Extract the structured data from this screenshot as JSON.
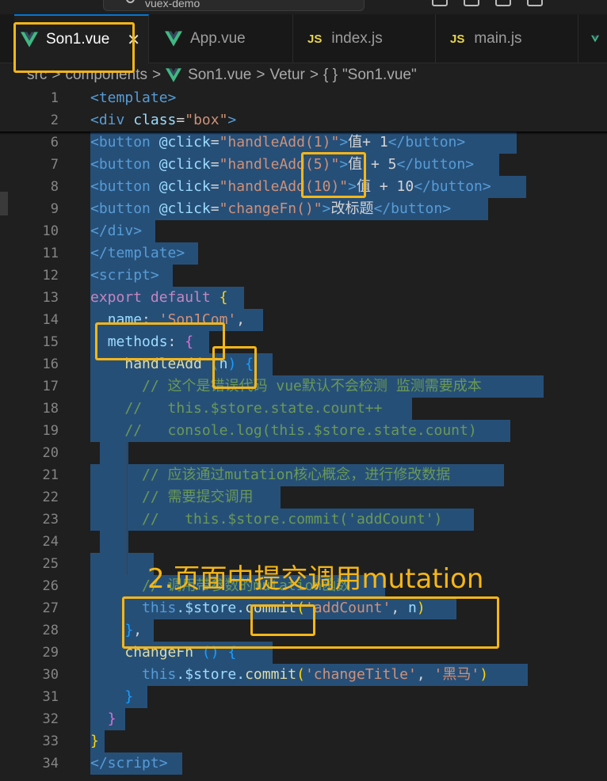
{
  "titlebar": {
    "search_text": "vuex-demo"
  },
  "tabs": [
    {
      "label": "Son1.vue",
      "icon": "vue-icon",
      "active": true,
      "close": "✕"
    },
    {
      "label": "App.vue",
      "icon": "vue-icon"
    },
    {
      "label": "index.js",
      "icon": "js-icon",
      "icon_text": "JS"
    },
    {
      "label": "main.js",
      "icon": "js-icon",
      "icon_text": "JS"
    }
  ],
  "breadcrumb": {
    "items": [
      "src",
      "components",
      "Son1.vue",
      "Vetur",
      "\"Son1.vue\""
    ],
    "separator": ">",
    "braces": "{ }"
  },
  "editor": {
    "lines": [
      {
        "no": "1"
      },
      {
        "no": "2"
      },
      {
        "no": "6"
      },
      {
        "no": "7"
      },
      {
        "no": "8"
      },
      {
        "no": "9"
      },
      {
        "no": "10"
      },
      {
        "no": "11"
      },
      {
        "no": "12"
      },
      {
        "no": "13"
      },
      {
        "no": "14"
      },
      {
        "no": "15"
      },
      {
        "no": "16"
      },
      {
        "no": "17"
      },
      {
        "no": "18"
      },
      {
        "no": "19"
      },
      {
        "no": "20"
      },
      {
        "no": "21"
      },
      {
        "no": "22"
      },
      {
        "no": "23"
      },
      {
        "no": "24"
      },
      {
        "no": "25"
      },
      {
        "no": "26"
      },
      {
        "no": "27"
      },
      {
        "no": "28"
      },
      {
        "no": "29"
      },
      {
        "no": "30"
      },
      {
        "no": "31"
      },
      {
        "no": "32"
      },
      {
        "no": "33"
      },
      {
        "no": "34"
      }
    ],
    "code": {
      "l1": "template",
      "l2_tag": "div",
      "l2_attr": "class",
      "l2_val": "\"box\"",
      "btn": "button",
      "click": "@click",
      "l6_val": "\"handleAdd(1)\"",
      "l6_text": "值+ 1",
      "l7_val": "\"handleAdd(5)\"",
      "l7_text": "值 + 5",
      "l8_val": "\"handleAdd(10)\"",
      "l8_text": "值 + 10",
      "l9_val": "\"changeFn()\"",
      "l9_text": "改标题",
      "l10": "/div",
      "l11": "/template",
      "l12": "script",
      "l13_kw": "export",
      "l13_kw2": "default",
      "l14_prop": "name",
      "l14_val": "'Son1Com'",
      "l15_prop": "methods",
      "l16_fn": "handleAdd",
      "l16_param": "n",
      "l17": "// 这个是错误代码 vue默认不会检测 监测需要成本",
      "l18": "//   this.$store.state.count++",
      "l19": "//   console.log(this.$store.state.count)",
      "l21": "// 应该通过mutation核心概念，进行修改数据",
      "l22": "// 需要提交调用",
      "l23": "//   this.$store.commit('addCount')",
      "l26": "// 调用带参数的mutation函数",
      "l27_this": "this",
      "l27_store": ".$store.",
      "l27_fn": "commit",
      "l27_arg1": "'addCount'",
      "l27_arg2": "n",
      "l29_fn": "changeFn",
      "l30_this": "this",
      "l30_store": ".$store.",
      "l30_fn": "commit",
      "l30_arg1": "'changeTitle'",
      "l30_arg2": "'黑马'",
      "l34": "/script"
    }
  },
  "annotation": {
    "text": "2.页面中提交调用mutation"
  }
}
